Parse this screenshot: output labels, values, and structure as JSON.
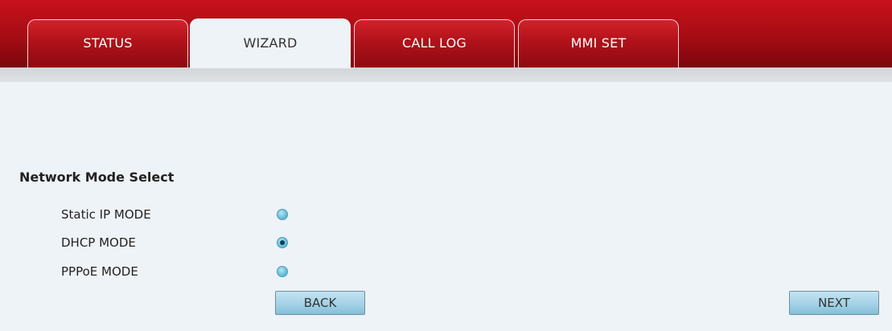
{
  "tabs": [
    {
      "label": "STATUS",
      "active": false
    },
    {
      "label": "WIZARD",
      "active": true
    },
    {
      "label": "CALL LOG",
      "active": false
    },
    {
      "label": "MMI SET",
      "active": false
    }
  ],
  "colors": {
    "header_red": "#b0121a",
    "page_bg": "#eef3f7",
    "button_blue": "#a7d4e8",
    "radio_blue": "#79c7df"
  },
  "section": {
    "title": "Network Mode Select"
  },
  "options": [
    {
      "label": "Static IP MODE",
      "checked": false
    },
    {
      "label": "DHCP MODE",
      "checked": true
    },
    {
      "label": "PPPoE MODE",
      "checked": false
    }
  ],
  "buttons": {
    "back_label": "BACK",
    "next_label": "NEXT"
  }
}
